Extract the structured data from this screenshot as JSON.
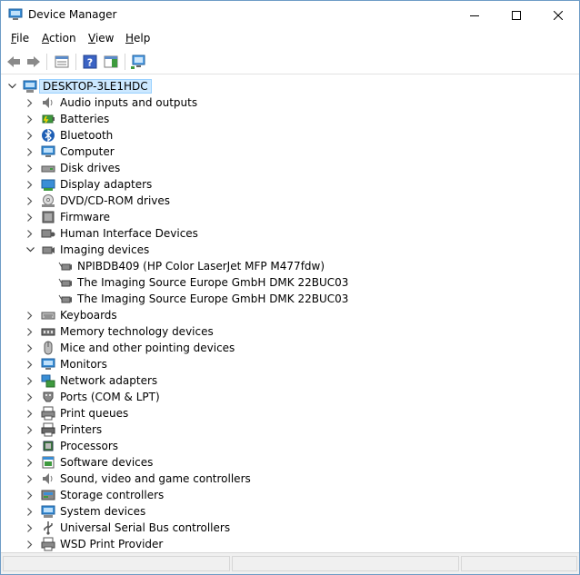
{
  "window": {
    "title": "Device Manager"
  },
  "menu": [
    {
      "label_pre": "",
      "accel": "F",
      "label_post": "ile"
    },
    {
      "label_pre": "",
      "accel": "A",
      "label_post": "ction"
    },
    {
      "label_pre": "",
      "accel": "V",
      "label_post": "iew"
    },
    {
      "label_pre": "",
      "accel": "H",
      "label_post": "elp"
    }
  ],
  "tree": {
    "root": "DESKTOP-3LE1HDC",
    "categories": [
      {
        "label": "Audio inputs and outputs",
        "icon": "speaker-icon"
      },
      {
        "label": "Batteries",
        "icon": "battery-icon"
      },
      {
        "label": "Bluetooth",
        "icon": "bluetooth-icon"
      },
      {
        "label": "Computer",
        "icon": "computer-icon"
      },
      {
        "label": "Disk drives",
        "icon": "disk-drive-icon"
      },
      {
        "label": "Display adapters",
        "icon": "display-adapter-icon"
      },
      {
        "label": "DVD/CD-ROM drives",
        "icon": "dvd-drive-icon"
      },
      {
        "label": "Firmware",
        "icon": "firmware-icon"
      },
      {
        "label": "Human Interface Devices",
        "icon": "hid-icon"
      },
      {
        "label": "Imaging devices",
        "icon": "camera-icon",
        "expanded": true,
        "children": [
          "NPIBDB409 (HP Color LaserJet MFP M477fdw)",
          "The Imaging Source Europe GmbH DMK 22BUC03",
          "The Imaging Source Europe GmbH DMK 22BUC03"
        ]
      },
      {
        "label": "Keyboards",
        "icon": "keyboard-icon"
      },
      {
        "label": "Memory technology devices",
        "icon": "memory-icon"
      },
      {
        "label": "Mice and other pointing devices",
        "icon": "mouse-icon"
      },
      {
        "label": "Monitors",
        "icon": "monitor-icon"
      },
      {
        "label": "Network adapters",
        "icon": "network-icon"
      },
      {
        "label": "Ports (COM & LPT)",
        "icon": "port-icon"
      },
      {
        "label": "Print queues",
        "icon": "print-queue-icon"
      },
      {
        "label": "Printers",
        "icon": "printer-icon"
      },
      {
        "label": "Processors",
        "icon": "processor-icon"
      },
      {
        "label": "Software devices",
        "icon": "software-device-icon"
      },
      {
        "label": "Sound, video and game controllers",
        "icon": "sound-icon"
      },
      {
        "label": "Storage controllers",
        "icon": "storage-icon"
      },
      {
        "label": "System devices",
        "icon": "system-icon"
      },
      {
        "label": "Universal Serial Bus controllers",
        "icon": "usb-icon"
      },
      {
        "label": "WSD Print Provider",
        "icon": "wsd-printer-icon"
      }
    ]
  },
  "colors": {
    "selection": "#cce8ff",
    "selection_border": "#99d1ff",
    "border": "#6e9cc6"
  }
}
